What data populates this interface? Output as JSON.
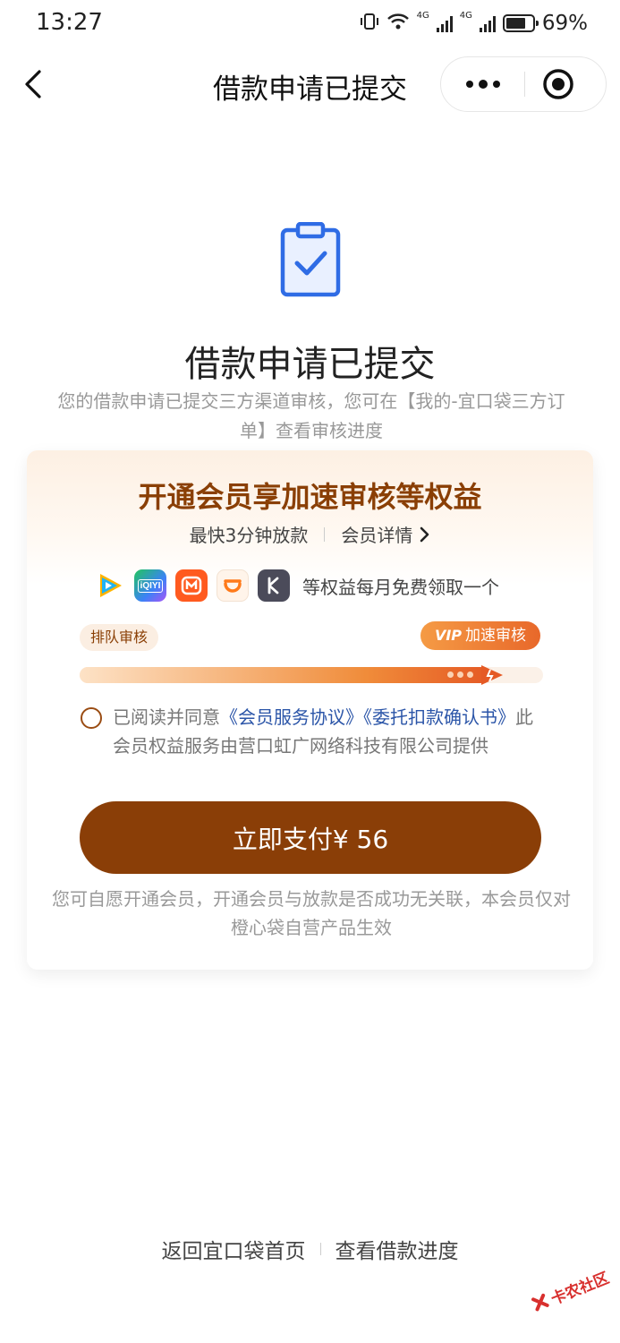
{
  "status_bar": {
    "time": "13:27",
    "network_1": "4G",
    "network_2": "4G",
    "battery_percent": "69%",
    "battery_level": 0.69
  },
  "nav": {
    "title": "借款申请已提交"
  },
  "success": {
    "title": "借款申请已提交",
    "description": "您的借款申请已提交三方渠道审核，您可在【我的-宜口袋三方订单】查看审核进度"
  },
  "membership": {
    "title": "开通会员享加速审核等权益",
    "fastest_loan": "最快3分钟放款",
    "details_link": "会员详情",
    "apps_text": "等权益每月免费领取一个",
    "apps": [
      {
        "icon": "tencent-video-icon",
        "color": "#1fb6ff"
      },
      {
        "icon": "iqiyi-icon",
        "label": "iQIYI",
        "color": "#22c55e"
      },
      {
        "icon": "mango-tv-icon",
        "color": "#ff5a1f"
      },
      {
        "icon": "didi-icon",
        "color": "#ff7a1a"
      },
      {
        "icon": "keep-icon",
        "color": "#4b4b5a"
      }
    ],
    "queue_label": "排队审核",
    "vip_mark": "VIP",
    "vip_label": "加速审核",
    "progress": 0.92
  },
  "agreement": {
    "prefix": "已阅读并同意",
    "link1": "《会员服务协议》",
    "link2": "《委托扣款确认书》",
    "suffix": "此会员权益服务由营口虹广网络科技有限公司提供"
  },
  "pay_button": {
    "label": "立即支付¥ 56"
  },
  "disclaimer": "您可自愿开通会员，开通会员与放款是否成功无关联，本会员仅对橙心袋自营产品生效",
  "bottom": {
    "home_link": "返回宜口袋首页",
    "progress_link": "查看借款进度"
  },
  "watermark": {
    "text": "卡农社区"
  },
  "colors": {
    "brand_brown": "#8a3e07",
    "link_blue": "#2b55a8",
    "accent_orange": "#e8682a",
    "success_blue": "#2f6ce5"
  }
}
